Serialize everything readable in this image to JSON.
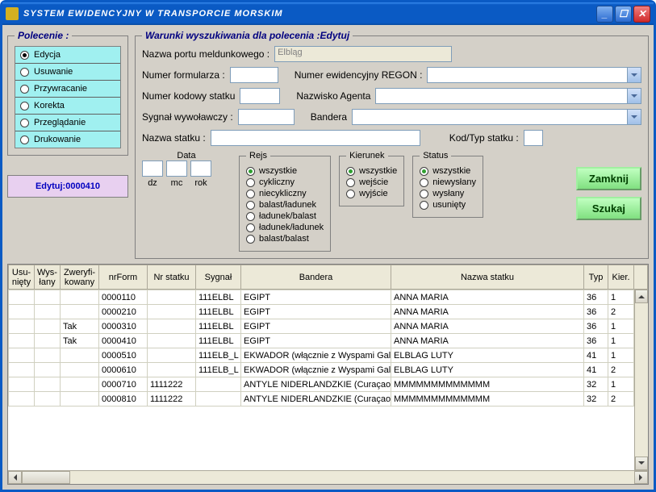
{
  "window": {
    "title": "SYSTEM  EWIDENCYJNY  W  TRANSPORCIE  MORSKIM"
  },
  "polecenie": {
    "legend": "Polecenie :",
    "items": [
      {
        "label": "Edycja",
        "selected": true
      },
      {
        "label": "Usuwanie",
        "selected": false
      },
      {
        "label": "Przywracanie",
        "selected": false
      },
      {
        "label": "Korekta",
        "selected": false
      },
      {
        "label": "Przeglądanie",
        "selected": false
      },
      {
        "label": "Drukowanie",
        "selected": false
      }
    ]
  },
  "editbox": "Edytuj:0000410",
  "warunki": {
    "legend": "Warunki wyszukiwania dla polecenia :Edytuj",
    "port_label": "Nazwa portu meldunkowego :",
    "port_value": "Elbląg",
    "numer_form_label": "Numer formularza :",
    "regon_label": "Numer ewidencyjny REGON :",
    "kodowy_label": "Numer kodowy statku",
    "agent_label": "Nazwisko Agenta",
    "sygnal_label": "Sygnał wywoławczy :",
    "bandera_label": "Bandera",
    "nazwa_statku_label": "Nazwa statku :",
    "kodtyp_label": "Kod/Typ statku :",
    "data": {
      "legend": "Data",
      "dz": "dz",
      "mc": "mc",
      "rok": "rok"
    },
    "rejs": {
      "legend": "Rejs",
      "items": [
        {
          "label": "wszystkie",
          "selected": true
        },
        {
          "label": "cykliczny",
          "selected": false
        },
        {
          "label": "niecykliczny",
          "selected": false
        },
        {
          "label": "balast/ładunek",
          "selected": false
        },
        {
          "label": "ładunek/balast",
          "selected": false
        },
        {
          "label": "ładunek/ładunek",
          "selected": false
        },
        {
          "label": "balast/balast",
          "selected": false
        }
      ]
    },
    "kierunek": {
      "legend": "Kierunek",
      "items": [
        {
          "label": "wszystkie",
          "selected": true
        },
        {
          "label": "wejście",
          "selected": false
        },
        {
          "label": "wyjście",
          "selected": false
        }
      ]
    },
    "status": {
      "legend": "Status",
      "items": [
        {
          "label": "wszystkie",
          "selected": true
        },
        {
          "label": "niewysłany",
          "selected": false
        },
        {
          "label": "wysłany",
          "selected": false
        },
        {
          "label": "usunięty",
          "selected": false
        }
      ]
    },
    "btn_zamknij": "Zamknij",
    "btn_szukaj": "Szukaj"
  },
  "grid": {
    "headers": [
      "Usu-nięty",
      "Wys-łany",
      "Zweryfi-kowany",
      "nrForm",
      "Nr statku",
      "Sygnał",
      "Bandera",
      "Nazwa statku",
      "Typ",
      "Kier."
    ],
    "rows": [
      {
        "usu": "",
        "wys": "",
        "zwer": "",
        "nrform": "0000110",
        "nrstatku": "",
        "sygnal": "111ELBL",
        "bandera": "EGIPT",
        "nazwa": "ANNA MARIA",
        "typ": "36",
        "kier": "1"
      },
      {
        "usu": "",
        "wys": "",
        "zwer": "",
        "nrform": "0000210",
        "nrstatku": "",
        "sygnal": "111ELBL",
        "bandera": "EGIPT",
        "nazwa": "ANNA MARIA",
        "typ": "36",
        "kier": "2"
      },
      {
        "usu": "",
        "wys": "",
        "zwer": "Tak",
        "nrform": "0000310",
        "nrstatku": "",
        "sygnal": "111ELBL",
        "bandera": "EGIPT",
        "nazwa": "ANNA MARIA",
        "typ": "36",
        "kier": "1"
      },
      {
        "usu": "",
        "wys": "",
        "zwer": "Tak",
        "nrform": "0000410",
        "nrstatku": "",
        "sygnal": "111ELBL",
        "bandera": "EGIPT",
        "nazwa": "ANNA MARIA",
        "typ": "36",
        "kier": "1"
      },
      {
        "usu": "",
        "wys": "",
        "zwer": "",
        "nrform": "0000510",
        "nrstatku": "",
        "sygnal": "111ELB_L",
        "bandera": "EKWADOR (włącznie z Wyspami Gal",
        "nazwa": "ELBLAG LUTY",
        "typ": "41",
        "kier": "1"
      },
      {
        "usu": "",
        "wys": "",
        "zwer": "",
        "nrform": "0000610",
        "nrstatku": "",
        "sygnal": "111ELB_L",
        "bandera": "EKWADOR (włącznie z Wyspami Gal",
        "nazwa": "ELBLAG LUTY",
        "typ": "41",
        "kier": "2"
      },
      {
        "usu": "",
        "wys": "",
        "zwer": "",
        "nrform": "0000710",
        "nrstatku": "1111222",
        "sygnal": "",
        "bandera": "ANTYLE NIDERLANDZKIE (Curaçao, I",
        "nazwa": "MMMMMMMMMMMMM",
        "typ": "32",
        "kier": "1"
      },
      {
        "usu": "",
        "wys": "",
        "zwer": "",
        "nrform": "0000810",
        "nrstatku": "1111222",
        "sygnal": "",
        "bandera": "ANTYLE NIDERLANDZKIE (Curaçao, I",
        "nazwa": "MMMMMMMMMMMMM",
        "typ": "32",
        "kier": "2"
      }
    ]
  }
}
